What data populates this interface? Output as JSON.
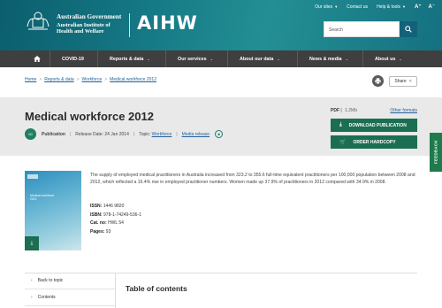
{
  "header": {
    "gov_line1": "Australian Government",
    "gov_line2": "Australian Institute of",
    "gov_line3": "Health and Welfare",
    "logo_text": "AIHW",
    "utility": {
      "our_sites": "Our sites",
      "contact": "Contact us",
      "help": "Help & tools",
      "font_up": "A⁺",
      "font_down": "A⁻"
    },
    "search_placeholder": "Search"
  },
  "nav": {
    "home_icon": "home-icon",
    "items": [
      "COVID-19",
      "Reports & data",
      "Our services",
      "About our data",
      "News & media",
      "About us"
    ]
  },
  "breadcrumb": [
    "Home",
    "Reports & data",
    "Workforce",
    "Medical workforce 2012"
  ],
  "share_label": "Share",
  "title_band": {
    "title": "Medical workforce 2012",
    "type": "Publication",
    "release_label": "Release Date:",
    "release_date": "24 Jan 2014",
    "topic_label": "Topic:",
    "topic": "Workforce",
    "media_release": "Media release",
    "pdf_label": "PDF",
    "pdf_size": "1.2Mb",
    "other_formats": "Other formats",
    "download_label": "DOWNLOAD PUBLICATION",
    "order_label": "ORDER HARDCOPY",
    "pub_icon_text": "00"
  },
  "feedback_label": "FEEDBACK",
  "cover": {
    "title_line1": "Medical workforce",
    "title_line2": "2012"
  },
  "description": "The supply of employed medical practitioners in Australia increased from 323.2 to 355.6 full-time equivalent practitioners per 100,000 population between 2008 and 2012, which reflected a 16.4% rise in employed practitioner numbers. Women made up 37.9% of practitioners in 2012 compared with 34.9% in 2008.",
  "facts": {
    "issn_label": "ISSN:",
    "issn": "1446 9820",
    "isbn_label": "ISBN:",
    "isbn": "978-1-74249-536-1",
    "cat_label": "Cat. no:",
    "cat": "HWL 54",
    "pages_label": "Pages:",
    "pages": "93"
  },
  "side_nav": [
    "Back to topic",
    "Contents"
  ],
  "toc_title": "Table of contents",
  "colors": {
    "header_teal": "#167a86",
    "nav_dark": "#3f3f3f",
    "button_green": "#1b6e51",
    "link_blue": "#1f5f9a"
  }
}
